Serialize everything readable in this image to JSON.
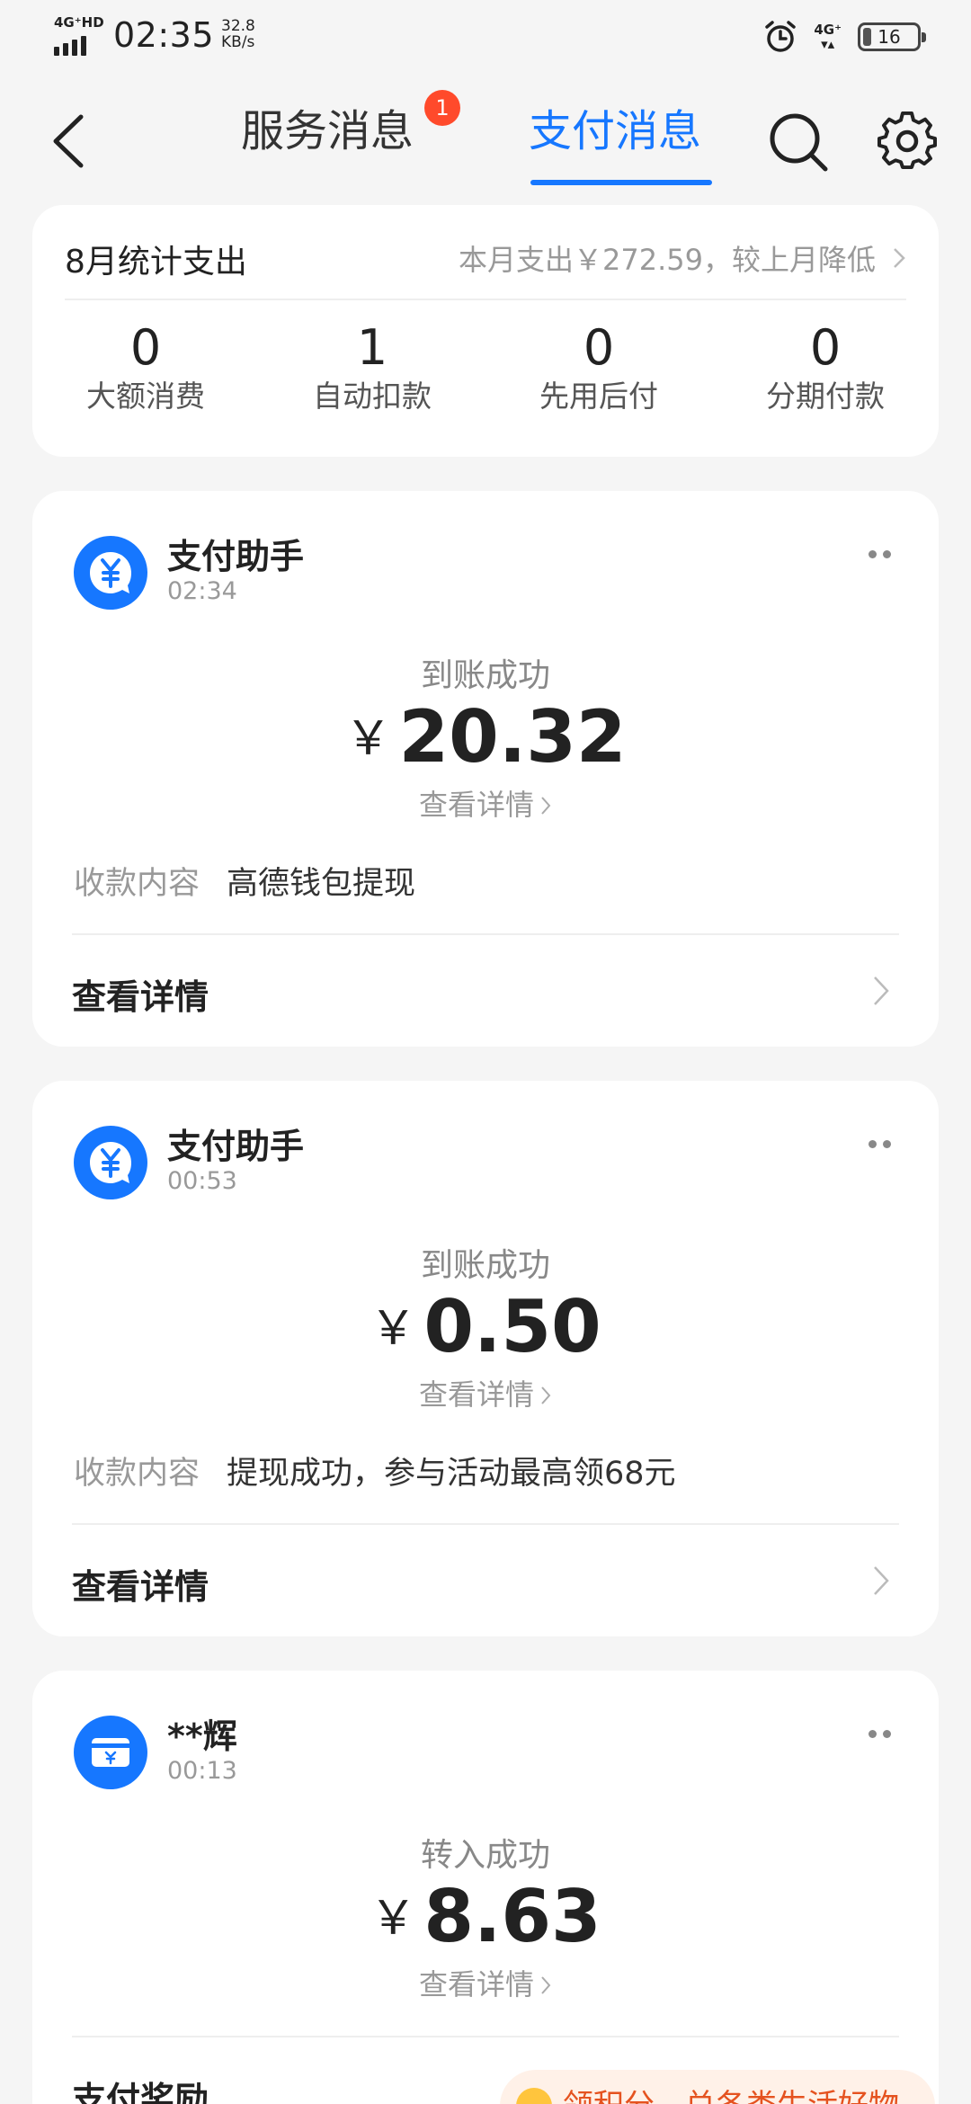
{
  "status_bar": {
    "network": "4G⁺HD",
    "time": "02:35",
    "speed_value": "32.8",
    "speed_unit": "KB/s",
    "network_right": "4G⁺",
    "battery": "16"
  },
  "nav": {
    "tab_service": "服务消息",
    "tab_service_badge": "1",
    "tab_pay": "支付消息",
    "active_color": "#1677ff"
  },
  "stats": {
    "title": "8月统计支出",
    "summary": "本月支出￥272.59，较上月降低",
    "items": [
      {
        "value": "0",
        "label": "大额消费"
      },
      {
        "value": "1",
        "label": "自动扣款"
      },
      {
        "value": "0",
        "label": "先用后付"
      },
      {
        "value": "0",
        "label": "分期付款"
      }
    ]
  },
  "messages": [
    {
      "sender": "支付助手",
      "time": "02:34",
      "icon": "yuan-bubble-icon",
      "status": "到账成功",
      "currency": "￥",
      "amount": "20.32",
      "detail_link": "查看详情",
      "content_label": "收款内容",
      "content": "高德钱包提现",
      "footer": "查看详情"
    },
    {
      "sender": "支付助手",
      "time": "00:53",
      "icon": "yuan-bubble-icon",
      "status": "到账成功",
      "currency": "￥",
      "amount": "0.50",
      "detail_link": "查看详情",
      "content_label": "收款内容",
      "content": "提现成功，参与活动最高领68元",
      "footer": "查看详情"
    },
    {
      "sender": "**辉",
      "time": "00:13",
      "icon": "card-transfer-icon",
      "status": "转入成功",
      "currency": "￥",
      "amount": "8.63",
      "detail_link": "查看详情",
      "footer": "支付奖励",
      "reward": "领积分，兑各类生活好物"
    }
  ]
}
